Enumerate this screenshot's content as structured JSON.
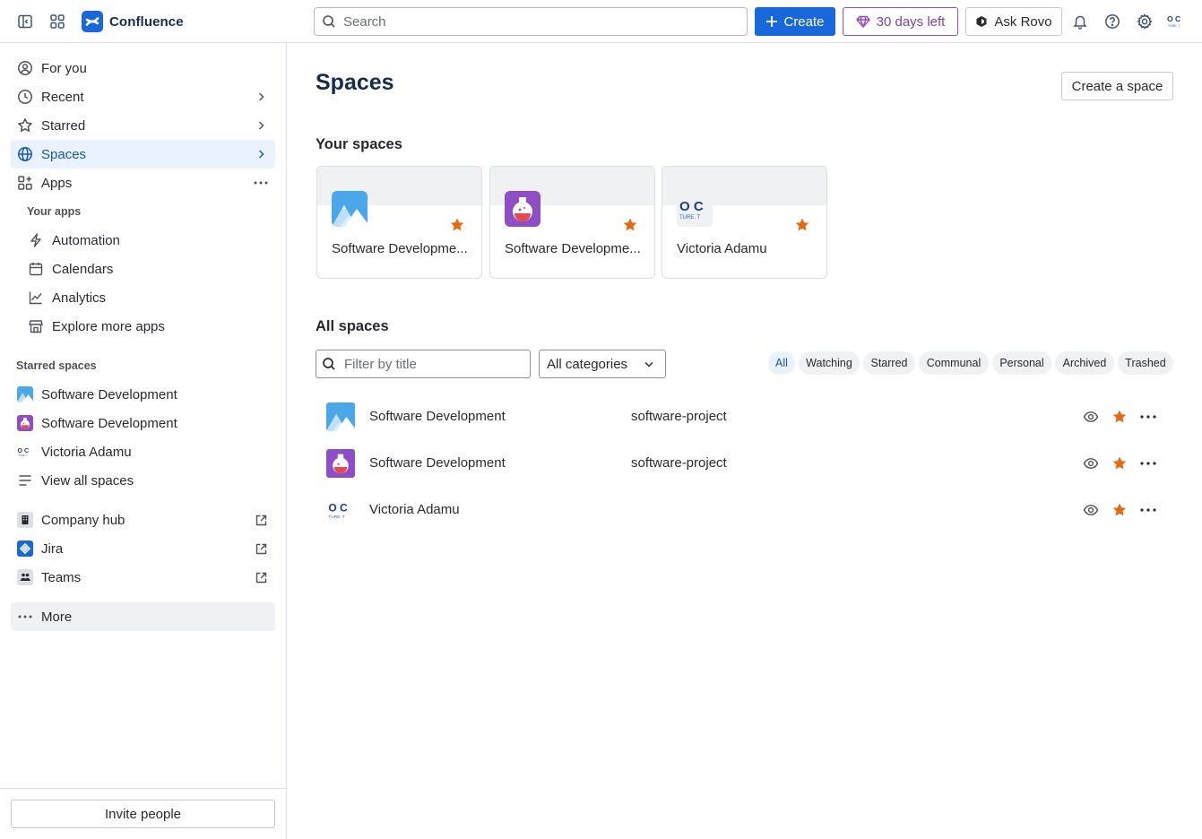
{
  "app": {
    "name": "Confluence",
    "brand_color": "#1868db",
    "search_placeholder": "Search",
    "create_label": "Create",
    "trial_label": "30 days left",
    "rovo_label": "Ask Rovo"
  },
  "sidebar": {
    "items": [
      {
        "label": "For you",
        "icon": "user-circle-icon"
      },
      {
        "label": "Recent",
        "icon": "clock-icon"
      },
      {
        "label": "Starred",
        "icon": "star-icon"
      },
      {
        "label": "Spaces",
        "icon": "globe-icon",
        "active": true
      },
      {
        "label": "Apps",
        "icon": "apps-icon"
      }
    ],
    "your_apps_label": "Your apps",
    "apps": [
      {
        "label": "Automation",
        "icon": "lightning-icon"
      },
      {
        "label": "Calendars",
        "icon": "calendar-icon"
      },
      {
        "label": "Analytics",
        "icon": "chart-icon"
      },
      {
        "label": "Explore more apps",
        "icon": "store-icon"
      }
    ],
    "starred_spaces_label": "Starred spaces",
    "starred_spaces": [
      {
        "label": "Software Development",
        "icon": "mountains-avatar"
      },
      {
        "label": "Software Development",
        "icon": "potion-avatar"
      },
      {
        "label": "Victoria Adamu",
        "icon": "oc-logo-avatar"
      }
    ],
    "view_all_label": "View all spaces",
    "external": [
      {
        "label": "Company hub",
        "icon": "building-icon"
      },
      {
        "label": "Jira",
        "icon": "jira-icon"
      },
      {
        "label": "Teams",
        "icon": "teams-icon"
      }
    ],
    "more_label": "More",
    "invite_label": "Invite people"
  },
  "main": {
    "title": "Spaces",
    "create_space_label": "Create a space",
    "your_spaces_heading": "Your spaces",
    "your_spaces": [
      {
        "title": "Software Developme...",
        "icon": "mountains-avatar",
        "starred": true
      },
      {
        "title": "Software Developme...",
        "icon": "potion-avatar",
        "starred": true
      },
      {
        "title": "Victoria Adamu",
        "icon": "oc-logo-avatar",
        "starred": true
      }
    ],
    "all_spaces_heading": "All spaces",
    "filter_placeholder": "Filter by title",
    "category_value": "All categories",
    "chips": [
      "All",
      "Watching",
      "Starred",
      "Communal",
      "Personal",
      "Archived",
      "Trashed"
    ],
    "active_chip": "All",
    "rows": [
      {
        "name": "Software Development",
        "key": "software-project",
        "icon": "mountains-avatar"
      },
      {
        "name": "Software Development",
        "key": "software-project",
        "icon": "potion-avatar"
      },
      {
        "name": "Victoria Adamu",
        "key": "",
        "icon": "oc-logo-avatar"
      }
    ],
    "logo_text_top": "O C",
    "logo_text_bottom": "TURE. T"
  },
  "colors": {
    "accent": "#1868db",
    "active_bg": "#e9f2fe",
    "star": "#e56910",
    "trial": "#803fa5"
  }
}
